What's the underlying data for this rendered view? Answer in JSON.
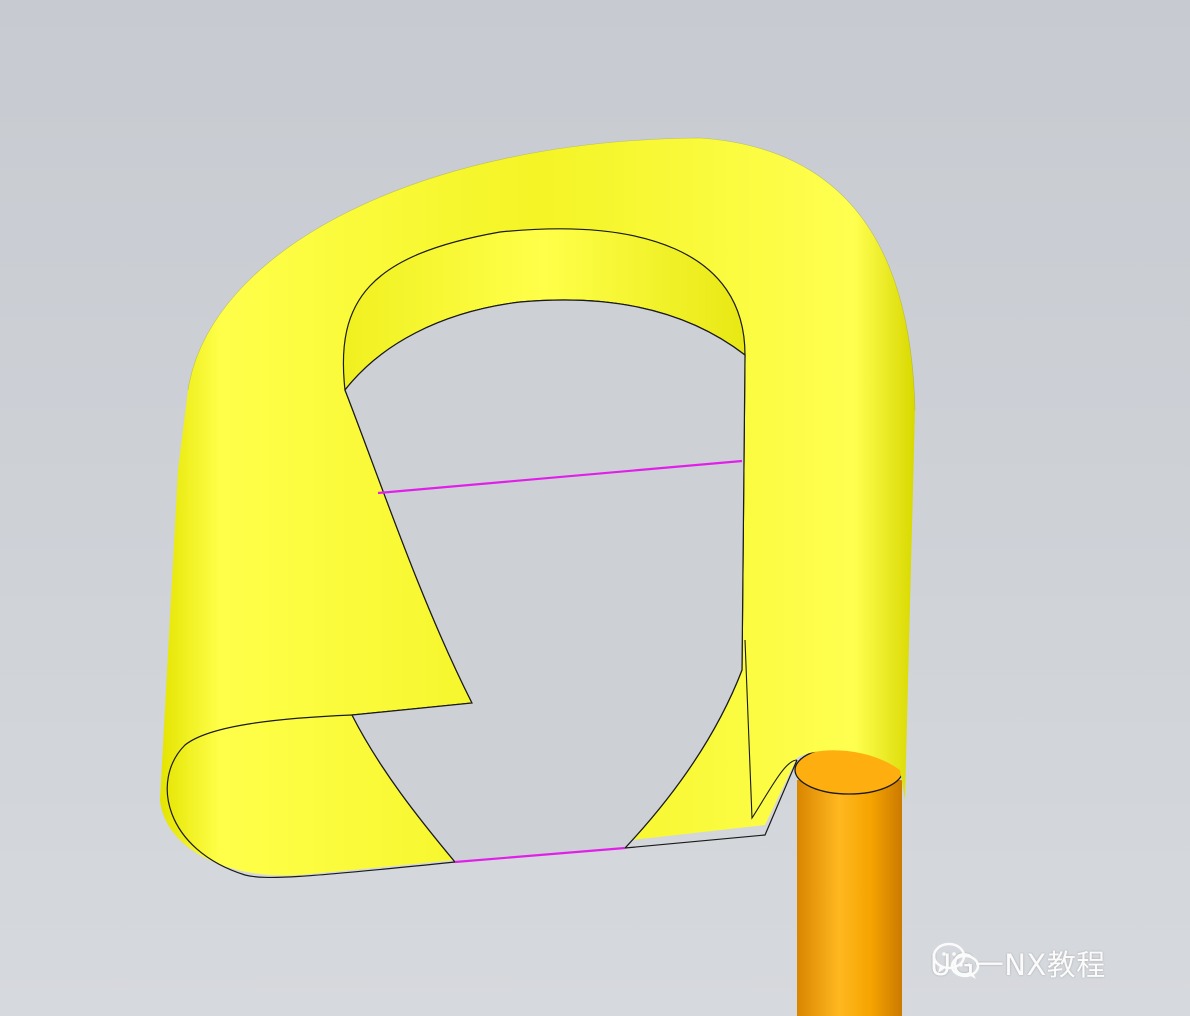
{
  "window": {
    "title": ""
  },
  "viewport": {
    "background": "#cdd1d6"
  },
  "model": {
    "surface_color": "#f2f22a",
    "surface_highlight": "#ffff55",
    "surface_shade": "#d9d900",
    "edge_color": "#1a1a1a",
    "selected_curve_color": "#e020e8",
    "rod_color": "#f5a400",
    "rod_highlight": "#ffc23a",
    "rod_shade": "#d88400"
  },
  "watermark": {
    "icon": "wechat-icon",
    "text": "UG一NX教程"
  }
}
